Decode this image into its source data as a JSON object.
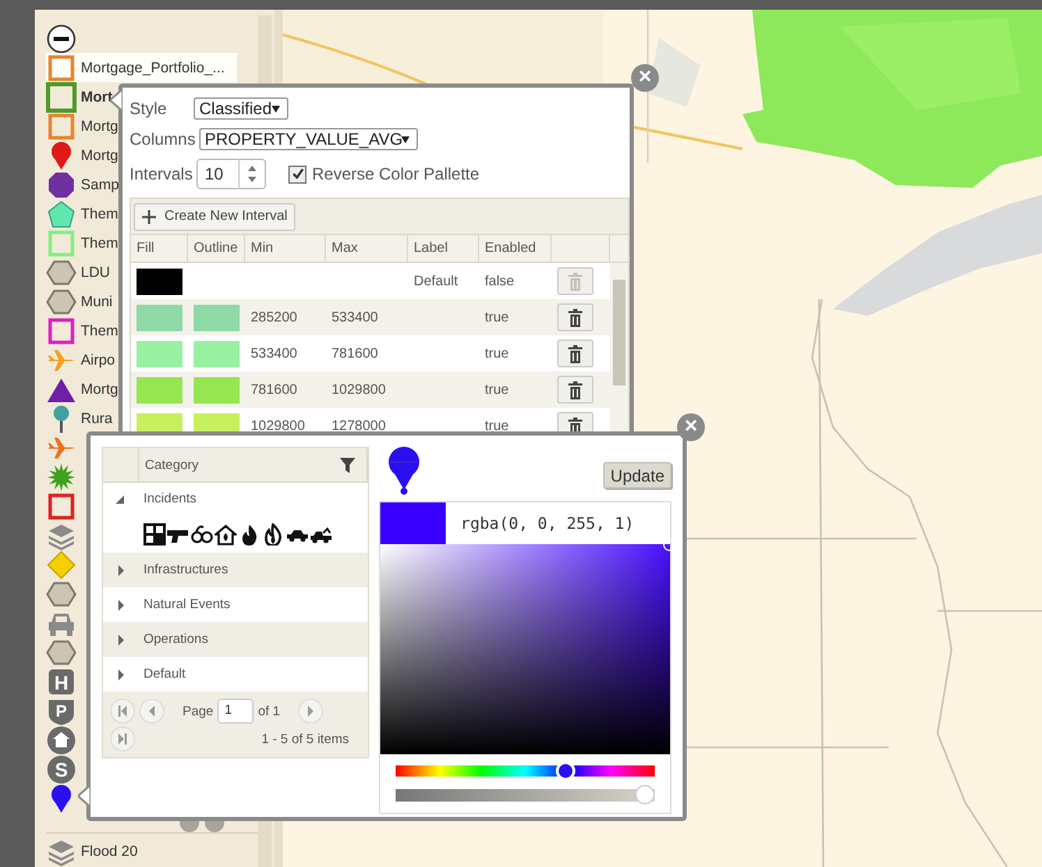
{
  "sidebar": {
    "layers": [
      {
        "label": "Mortgage_Portfolio_...",
        "kind": "square",
        "color": "#e8842e",
        "selected": false,
        "hover": true
      },
      {
        "label": "Mort",
        "kind": "square",
        "color": "#4f9a28",
        "selected": true,
        "hover": false
      },
      {
        "label": "Mortg",
        "kind": "square",
        "color": "#e8842e",
        "selected": false,
        "hover": false
      },
      {
        "label": "Mortg",
        "kind": "pin",
        "color": "#e01818",
        "selected": false,
        "hover": false
      },
      {
        "label": "Samp",
        "kind": "octagon",
        "color": "#7030a0",
        "selected": false,
        "hover": false
      },
      {
        "label": "Them",
        "kind": "pentagon",
        "color": "#60e8b0",
        "selected": false,
        "hover": false
      },
      {
        "label": "Them",
        "kind": "square",
        "color": "#80f080",
        "selected": false,
        "hover": false
      },
      {
        "label": "LDU",
        "kind": "hexagon",
        "color": "#cdc5b4",
        "selected": false,
        "hover": false
      },
      {
        "label": "Muni",
        "kind": "hexagon",
        "color": "#cdc5b4",
        "selected": false,
        "hover": false
      },
      {
        "label": "Them",
        "kind": "square",
        "color": "#e020c0",
        "selected": false,
        "hover": false
      },
      {
        "label": "Airpo",
        "kind": "plane",
        "color": "#f0a020",
        "selected": false,
        "hover": false
      },
      {
        "label": "Mortg",
        "kind": "triangle",
        "color": "#7020a8",
        "selected": false,
        "hover": false
      },
      {
        "label": "Rura",
        "kind": "pushpin",
        "color": "#40a0a0",
        "selected": false,
        "hover": false
      },
      {
        "kind": "plane",
        "color": "#f07020",
        "selected": false,
        "hover": false
      },
      {
        "kind": "flower",
        "color": "#40a020",
        "selected": false,
        "hover": false
      },
      {
        "kind": "square",
        "color": "#e02020",
        "selected": false,
        "hover": false
      },
      {
        "kind": "layers",
        "color": "#8a8a8a",
        "selected": false,
        "hover": false
      },
      {
        "kind": "diamond",
        "color": "#f5d000",
        "selected": false,
        "hover": false
      },
      {
        "kind": "hexagon",
        "color": "#cdc5b4",
        "selected": false,
        "hover": false
      },
      {
        "kind": "car",
        "color": "#8a8a8a",
        "selected": false,
        "hover": false
      },
      {
        "kind": "hexagon",
        "color": "#cdc5b4",
        "selected": false,
        "hover": false
      },
      {
        "kind": "badge",
        "color": "#6a6a6a",
        "badge": "H",
        "selected": false,
        "hover": false
      },
      {
        "kind": "shield",
        "color": "#6a6a6a",
        "badge": "P",
        "selected": false,
        "hover": false
      },
      {
        "kind": "house",
        "color": "#6a6a6a",
        "selected": false,
        "hover": false
      },
      {
        "kind": "letter-circle",
        "color": "#6a6a6a",
        "badge": "S",
        "selected": false,
        "hover": false
      },
      {
        "kind": "pin",
        "color": "#2a10f0",
        "selected": false,
        "hover": false
      }
    ],
    "footer_layer": {
      "label": "Flood 20",
      "kind": "layers",
      "color": "#8a8a8a"
    }
  },
  "style_popup": {
    "close": "×",
    "style": {
      "label": "Style",
      "value": "Classified"
    },
    "columns": {
      "label": "Columns",
      "value": "PROPERTY_VALUE_AVG"
    },
    "intervals": {
      "label": "Intervals",
      "value": "10"
    },
    "reverse": {
      "label": "Reverse Color Pallette",
      "checked": true
    },
    "create_button": "Create New Interval",
    "table": {
      "columns": [
        "Fill",
        "Outline",
        "Min",
        "Max",
        "Label",
        "Enabled"
      ],
      "rows": [
        {
          "fill": {
            "color": "#000000"
          },
          "label": "Default",
          "enabled": "false",
          "disabled": true
        },
        {
          "fill": {
            "color": "#8ed9a6"
          },
          "outline": {
            "color": "#8ed9a6"
          },
          "min": "285200",
          "max": "533400",
          "enabled": "true",
          "disabled": false
        },
        {
          "fill": {
            "color": "#98f0a2"
          },
          "outline": {
            "color": "#98f0a2"
          },
          "min": "533400",
          "max": "781600",
          "enabled": "true",
          "disabled": false
        },
        {
          "fill": {
            "color": "#95e650"
          },
          "outline": {
            "color": "#95e650"
          },
          "min": "781600",
          "max": "1029800",
          "enabled": "true",
          "disabled": false
        },
        {
          "fill": {
            "color": "#c8ef5e"
          },
          "outline": {
            "color": "#c8ef5e"
          },
          "min": "1029800",
          "max": "1278000",
          "enabled": "true",
          "disabled": false
        }
      ]
    }
  },
  "symbol_popup": {
    "close": "×",
    "tree": {
      "header": "Category",
      "items": [
        {
          "label": "Incidents",
          "expanded": true
        },
        {
          "label": "Infrastructures",
          "expanded": false
        },
        {
          "label": "Natural Events",
          "expanded": false
        },
        {
          "label": "Operations",
          "expanded": false
        },
        {
          "label": "Default",
          "expanded": false
        }
      ]
    },
    "pager": {
      "page_label": "Page",
      "page": "1",
      "of": "of 1",
      "summary": "1 - 5 of 5 items"
    },
    "update_button": "Update",
    "color_picker": {
      "value": "rgba(0, 0, 255, 1)",
      "hue": {
        "level": 0.67
      },
      "alpha": {
        "level": 1
      }
    }
  }
}
